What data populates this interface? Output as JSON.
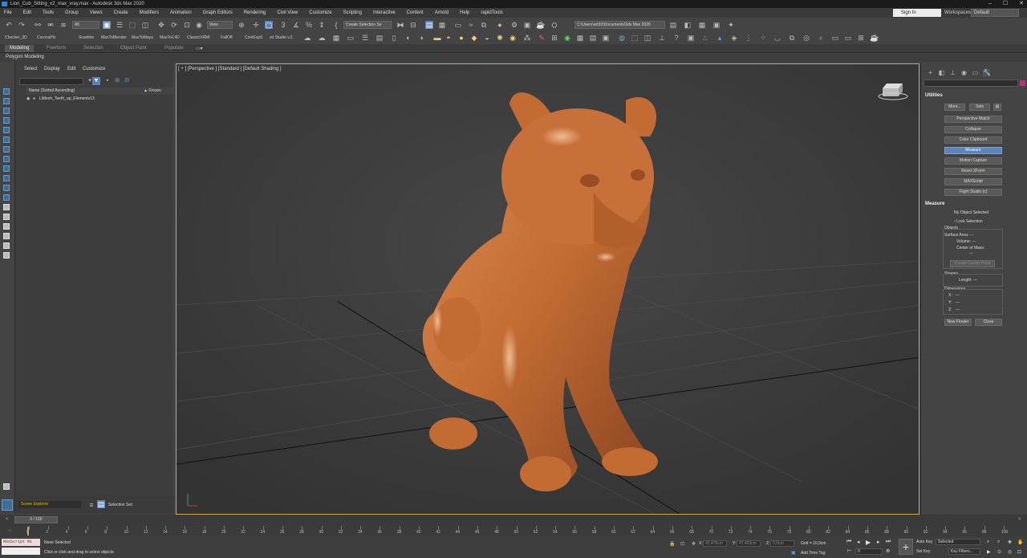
{
  "window": {
    "title": "Lion_Cub_Sitting_v2_max_vray.max - Autodesk 3ds Max 2020",
    "controls": [
      "–",
      "☐",
      "✕"
    ]
  },
  "menu": [
    "File",
    "Edit",
    "Tools",
    "Group",
    "Views",
    "Create",
    "Modifiers",
    "Animation",
    "Graph Editors",
    "Rendering",
    "Civil View",
    "Customize",
    "Scripting",
    "Interactive",
    "Content",
    "Arnold",
    "Help",
    "rapidTools"
  ],
  "account": {
    "signin": "Sign In",
    "workspaces_label": "Workspaces:",
    "workspace": "Default"
  },
  "toolbar": {
    "selection_filter": "All",
    "ref_coord": "View",
    "selection_set": "Create Selection Se",
    "path": "C:\\Users\\art30\\Documents\\3ds Max 2020",
    "plugins": [
      "Checker_3D",
      "CoronaPlx",
      "Scanline",
      "MaxToBlender",
      "MaxToMaya",
      "MaxToC4D",
      "ClassicVRMt",
      "FallOff",
      "ContExpS",
      "zd Studio v.2."
    ]
  },
  "ribbon": {
    "tabs": [
      "Modeling",
      "Freeform",
      "Selection",
      "Object Paint",
      "Populate"
    ],
    "subtitle": "Polygon Modeling"
  },
  "scene_explorer": {
    "menu": [
      "Select",
      "Display",
      "Edit",
      "Customize"
    ],
    "columns": {
      "name": "Name (Sorted Ascending)",
      "frozen": "▲ Frozen"
    },
    "rows": [
      "LiMesh_Teeth_up_Elements13"
    ],
    "footer_name": "Scene Explorer",
    "footer_set": "Selection Set:"
  },
  "viewport": {
    "label": "[ + ] [Perspective ] [Standard ] [Default Shading ]"
  },
  "command_panel": {
    "rollout_utilities": "Utilities",
    "more": "More...",
    "sets": "Sets",
    "utilities": [
      "Perspective Match",
      "Collapse",
      "Color Clipboard",
      "Measure",
      "Motion Capture",
      "Reset XForm",
      "MAXScript",
      "Flight Studio (c)"
    ],
    "selected_utility": "Measure",
    "rollout_measure": "Measure",
    "measure": {
      "no_object": "No Object Selected",
      "lock_selection": "Lock Selection",
      "objects_label": "Objects",
      "surface_area": "Surface Area: ---",
      "volume": "Volume: ---",
      "center_of_mass": "Center of Mass:",
      "dashes": "---",
      "create_center_point": "Create Center Point",
      "shapes_label": "Shapes",
      "length": "Length: ---",
      "dimensions_label": "Dimensions",
      "x": "X:",
      "y": "Y:",
      "z": "Z:",
      "dim_value": "---",
      "new_floater": "New Floater",
      "close": "Close"
    }
  },
  "timeline": {
    "frame": "0 / 100",
    "ticks": [
      "0",
      "2",
      "4",
      "6",
      "8",
      "10",
      "12",
      "14",
      "16",
      "18",
      "20",
      "22",
      "24",
      "26",
      "28",
      "30",
      "32",
      "34",
      "36",
      "38",
      "40",
      "42",
      "44",
      "46",
      "48",
      "50",
      "52",
      "54",
      "56",
      "58",
      "60",
      "62",
      "64",
      "66",
      "68",
      "70",
      "72",
      "74",
      "76",
      "78",
      "80",
      "82",
      "84",
      "86",
      "88",
      "90",
      "92",
      "94",
      "96",
      "98",
      "100"
    ]
  },
  "status": {
    "maxscript": "MAXScript Mi",
    "selected": "None Selected",
    "prompt": "Click or click-and-drag to select objects",
    "x_label": "X:",
    "x_val": "45,479cm",
    "y_label": "Y:",
    "y_val": "47,403cm",
    "z_label": "Z:",
    "z_val": "0,0cm",
    "grid": "Grid = 10,0cm",
    "add_time_tag": "Add Time Tag",
    "auto_key": "Auto Key",
    "set_key": "Set Key",
    "selected_dropdown": "Selected",
    "key_filters": "Key Filters...",
    "frame_input": "0"
  },
  "colors": {
    "viewport_border": "#c8a94b",
    "selected_button": "#5b84bd",
    "model": "#c26b33"
  }
}
